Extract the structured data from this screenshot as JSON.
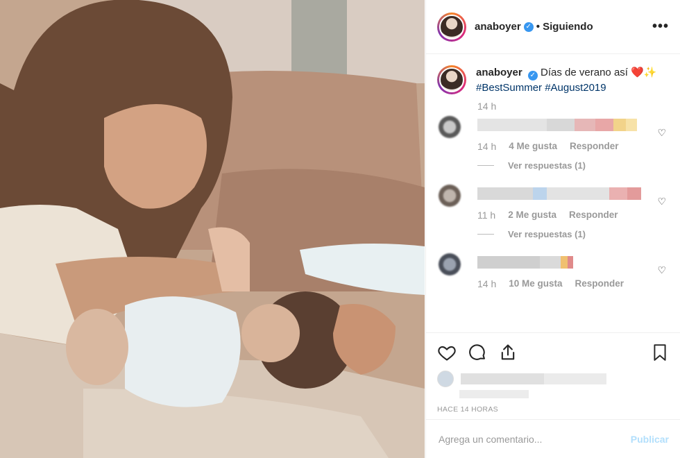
{
  "post": {
    "username": "anaboyer",
    "follow_status": "• Siguiendo",
    "more_label": "•••"
  },
  "caption": {
    "username": "anaboyer",
    "text": "Días de verano así ❤️✨",
    "hashtags": "#BestSummer #August2019",
    "time": "14 h"
  },
  "comments": [
    {
      "time": "14 h",
      "likes": "4 Me gusta",
      "reply": "Responder",
      "view_replies": "Ver respuestas (1)"
    },
    {
      "time": "11 h",
      "likes": "2 Me gusta",
      "reply": "Responder",
      "view_replies": "Ver respuestas (1)"
    },
    {
      "time": "14 h",
      "likes": "10 Me gusta",
      "reply": "Responder"
    }
  ],
  "footer": {
    "time_ago": "HACE 14 HORAS",
    "comment_placeholder": "Agrega un comentario...",
    "publish_label": "Publicar"
  },
  "colors": {
    "accent": "#3897f0",
    "hashtag": "#003569",
    "publish_disabled": "#b2dffc"
  }
}
